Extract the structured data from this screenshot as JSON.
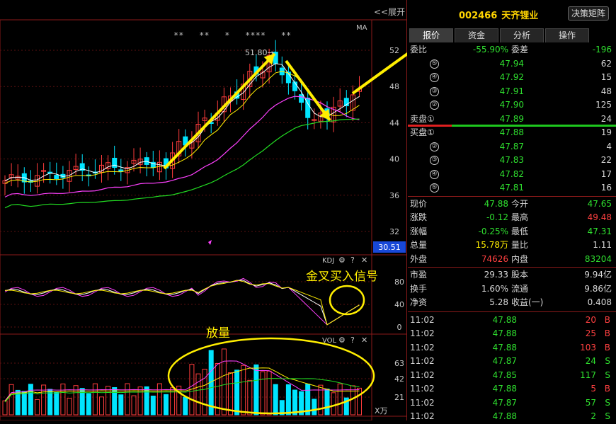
{
  "chart": {
    "expand_label": "<<展开",
    "ma_label": "MA",
    "stars_text": "** ** * **** **",
    "peak_label": "51.80",
    "price_ticks": [
      "52",
      "48",
      "44",
      "40",
      "36",
      "32"
    ],
    "cursor_value": "30.51",
    "kdj_label": "KDJ",
    "kdj_ticks": [
      "80",
      "40",
      "0"
    ],
    "vol_label": "VOL",
    "vol_ticks": [
      "63",
      "42",
      "21"
    ],
    "vol_unit": "X万",
    "annotations": {
      "golden_cross": "金叉买入信号",
      "volume": "放量"
    },
    "colors": {
      "up": "#ff3c3c",
      "down": "#00e5ff",
      "ma1": "#ffffff",
      "ma2": "#ffee00",
      "ma3": "#ff40ff",
      "ma4": "#22dd22",
      "annotation": "#ffee00"
    }
  },
  "header": {
    "code": "002466",
    "name": "天齐锂业",
    "decision_button": "决策矩阵"
  },
  "tabs": [
    {
      "label": "报价"
    },
    {
      "label": "资金"
    },
    {
      "label": "分析"
    },
    {
      "label": "操作"
    }
  ],
  "order_book": {
    "weibi_label": "委比",
    "weibi_value": "-55.90%",
    "weicha_label": "委差",
    "weicha_value": "-196",
    "sell": [
      {
        "level": "⑤",
        "price": "47.94",
        "volume": "62"
      },
      {
        "level": "④",
        "price": "47.92",
        "volume": "15"
      },
      {
        "level": "③",
        "price": "47.91",
        "volume": "48"
      },
      {
        "level": "②",
        "price": "47.90",
        "volume": "125"
      },
      {
        "level": "卖盘①",
        "price": "47.89",
        "volume": "24"
      }
    ],
    "buy": [
      {
        "level": "买盘①",
        "price": "47.88",
        "volume": "19"
      },
      {
        "level": "②",
        "price": "47.87",
        "volume": "4"
      },
      {
        "level": "③",
        "price": "47.83",
        "volume": "22"
      },
      {
        "level": "④",
        "price": "47.82",
        "volume": "17"
      },
      {
        "level": "⑤",
        "price": "47.81",
        "volume": "16"
      }
    ]
  },
  "quote": [
    {
      "l1": "现价",
      "v1": "47.88",
      "c1": "g",
      "l2": "今开",
      "v2": "47.65",
      "c2": "g"
    },
    {
      "l1": "涨跌",
      "v1": "-0.12",
      "c1": "g",
      "l2": "最高",
      "v2": "49.48",
      "c2": "r"
    },
    {
      "l1": "涨幅",
      "v1": "-0.25%",
      "c1": "g",
      "l2": "最低",
      "v2": "47.31",
      "c2": "g"
    },
    {
      "l1": "总量",
      "v1": "15.78万",
      "c1": "y",
      "l2": "量比",
      "v2": "1.11",
      "c2": "w"
    },
    {
      "l1": "外盘",
      "v1": "74626",
      "c1": "r",
      "l2": "内盘",
      "v2": "83204",
      "c2": "g"
    }
  ],
  "fundamentals": [
    {
      "l1": "市盈",
      "v1": "29.33",
      "l2": "股本",
      "v2": "9.94亿"
    },
    {
      "l1": "换手",
      "v1": "1.60%",
      "l2": "流通",
      "v2": "9.86亿"
    },
    {
      "l1": "净资",
      "v1": "5.28",
      "l2": "收益(一)",
      "v2": "0.408"
    }
  ],
  "ticks": [
    {
      "time": "11:02",
      "price": "47.88",
      "volume": "20",
      "side": "B"
    },
    {
      "time": "11:02",
      "price": "47.88",
      "volume": "25",
      "side": "B"
    },
    {
      "time": "11:02",
      "price": "47.88",
      "volume": "103",
      "side": "B"
    },
    {
      "time": "11:02",
      "price": "47.87",
      "volume": "24",
      "side": "S"
    },
    {
      "time": "11:02",
      "price": "47.85",
      "volume": "117",
      "side": "S"
    },
    {
      "time": "11:02",
      "price": "47.88",
      "volume": "5",
      "side": "B"
    },
    {
      "time": "11:02",
      "price": "47.87",
      "volume": "57",
      "side": "S"
    },
    {
      "time": "11:02",
      "price": "47.88",
      "volume": "2",
      "side": "S"
    }
  ]
}
